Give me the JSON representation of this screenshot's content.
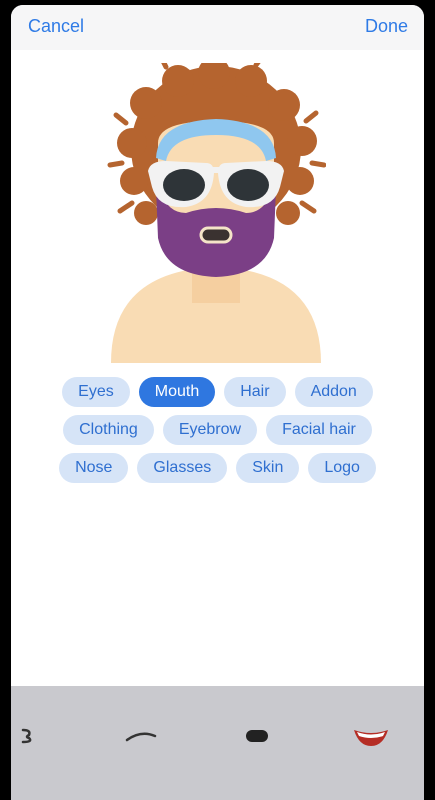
{
  "nav": {
    "cancel_label": "Cancel",
    "done_label": "Done"
  },
  "categories": {
    "row1": [
      {
        "label": "Eyes",
        "selected": false
      },
      {
        "label": "Mouth",
        "selected": true
      },
      {
        "label": "Hair",
        "selected": false
      },
      {
        "label": "Addon",
        "selected": false
      }
    ],
    "row2": [
      {
        "label": "Clothing",
        "selected": false
      },
      {
        "label": "Eyebrow",
        "selected": false
      },
      {
        "label": "Facial hair",
        "selected": false
      }
    ],
    "row3": [
      {
        "label": "Nose",
        "selected": false
      },
      {
        "label": "Glasses",
        "selected": false
      },
      {
        "label": "Skin",
        "selected": false
      },
      {
        "label": "Logo",
        "selected": false
      }
    ]
  },
  "mouth_options": [
    {
      "icon": "mouth-option-curl-icon"
    },
    {
      "icon": "mouth-option-line-icon"
    },
    {
      "icon": "mouth-option-oval-icon"
    },
    {
      "icon": "mouth-option-smile-icon"
    }
  ],
  "colors": {
    "accent": "#2f77e0",
    "chip_background": "#d6e4f7",
    "hair": "#b5642f",
    "beard": "#7b3f86",
    "headband": "#8fc7ef",
    "skin": "#f9dcb4",
    "tray": "#c9c9ce"
  }
}
